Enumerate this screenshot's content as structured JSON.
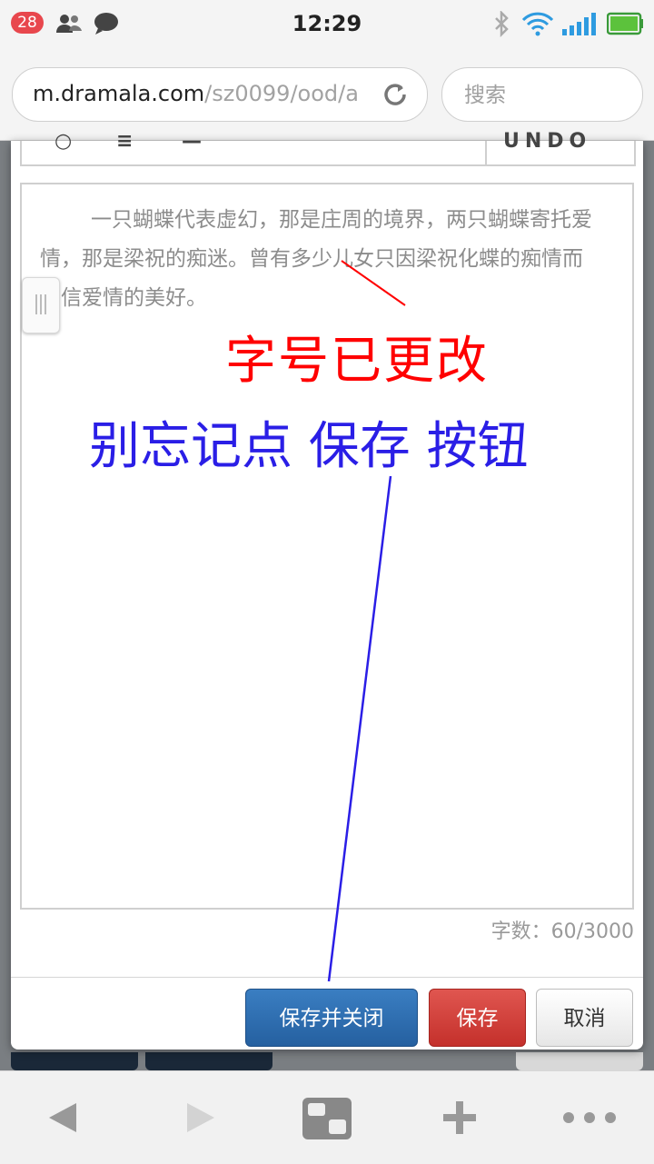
{
  "status_bar": {
    "notification_count": "28",
    "time": "12:29"
  },
  "browser": {
    "url_host": "m.dramala.com",
    "url_path": "/sz0099/ood/a",
    "search_placeholder": "搜索"
  },
  "editor": {
    "content": "一只蝴蝶代表虚幻，那是庄周的境界，两只蝴蝶寄托爱情，那是梁祝的痴迷。曾有多少儿女只因梁祝化蝶的痴情而坚信爱情的美好。",
    "word_count_label": "字数：",
    "word_count": "60/3000"
  },
  "buttons": {
    "save_close": "保存并关闭",
    "save": "保存",
    "cancel": "取消"
  },
  "annotations": {
    "font_changed": "字号已更改",
    "remember_save": "别忘记点 保存 按钮"
  },
  "colors": {
    "annotation_red": "#ff0000",
    "annotation_blue": "#2a1ee6",
    "primary_button": "#2a68a8",
    "danger_button": "#d23a35"
  }
}
